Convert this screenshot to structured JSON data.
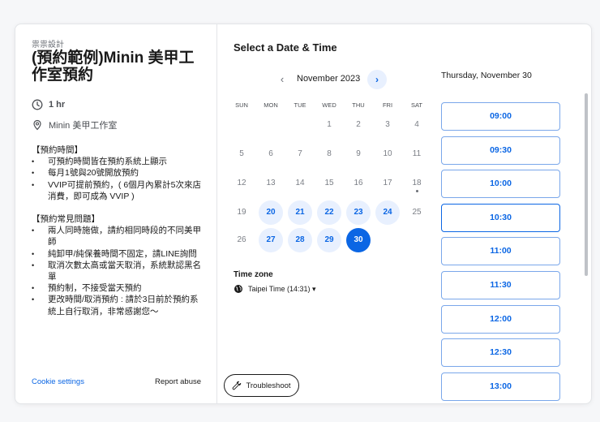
{
  "org_name": "祟祟設計",
  "event_title": "(預約範例)Minin 美甲工作室預約",
  "duration": "1 hr",
  "location": "Minin 美甲工作室",
  "description": {
    "section1_title": "【預約時間】",
    "section1_items": [
      "可預約時間皆在預約系統上顯示",
      "每月1號與20號開放預約",
      "VVIP可提前預約，( 6個月內累計5次來店消費，即可成為 VVIP )"
    ],
    "section2_title": "【預約常見問題】",
    "section2_items": [
      "兩人同時施做，請約相同時段的不同美甲師",
      "純卸甲/純保養時間不固定，請LINE詢問",
      "取消次數太高或當天取消，系統默認黑名單",
      "預約制，不接受當天預約",
      "更改時間/取消預約 : 請於3日前於預約系統上自行取消，非常感謝您～"
    ]
  },
  "footer": {
    "cookie_settings": "Cookie settings",
    "report_abuse": "Report abuse"
  },
  "calendar": {
    "heading": "Select a Date & Time",
    "month_label": "November 2023",
    "prev_icon": "‹",
    "next_icon": "›",
    "weekdays": [
      "SUN",
      "MON",
      "TUE",
      "WED",
      "THU",
      "FRI",
      "SAT"
    ],
    "weeks": [
      [
        "",
        "",
        "",
        "1",
        "2",
        "3",
        "4"
      ],
      [
        "5",
        "6",
        "7",
        "8",
        "9",
        "10",
        "11"
      ],
      [
        "12",
        "13",
        "14",
        "15",
        "16",
        "17",
        "18"
      ],
      [
        "19",
        "20",
        "21",
        "22",
        "23",
        "24",
        "25"
      ],
      [
        "26",
        "27",
        "28",
        "29",
        "30",
        "",
        ""
      ]
    ],
    "available_days": [
      "20",
      "21",
      "22",
      "23",
      "24",
      "27",
      "28",
      "29"
    ],
    "selected_day": "30",
    "today_dot_day": "18",
    "accent_color": "#0b66e4",
    "available_bg": "#e8f0fe"
  },
  "timezone": {
    "label": "Time zone",
    "value": "Taipei Time (14:31) ▾"
  },
  "troubleshoot_label": "Troubleshoot",
  "selected_date_label": "Thursday, November 30",
  "time_slots": [
    "09:00",
    "09:30",
    "10:00",
    "10:30",
    "11:00",
    "11:30",
    "12:00",
    "12:30",
    "13:00"
  ],
  "active_slot": "10:30"
}
